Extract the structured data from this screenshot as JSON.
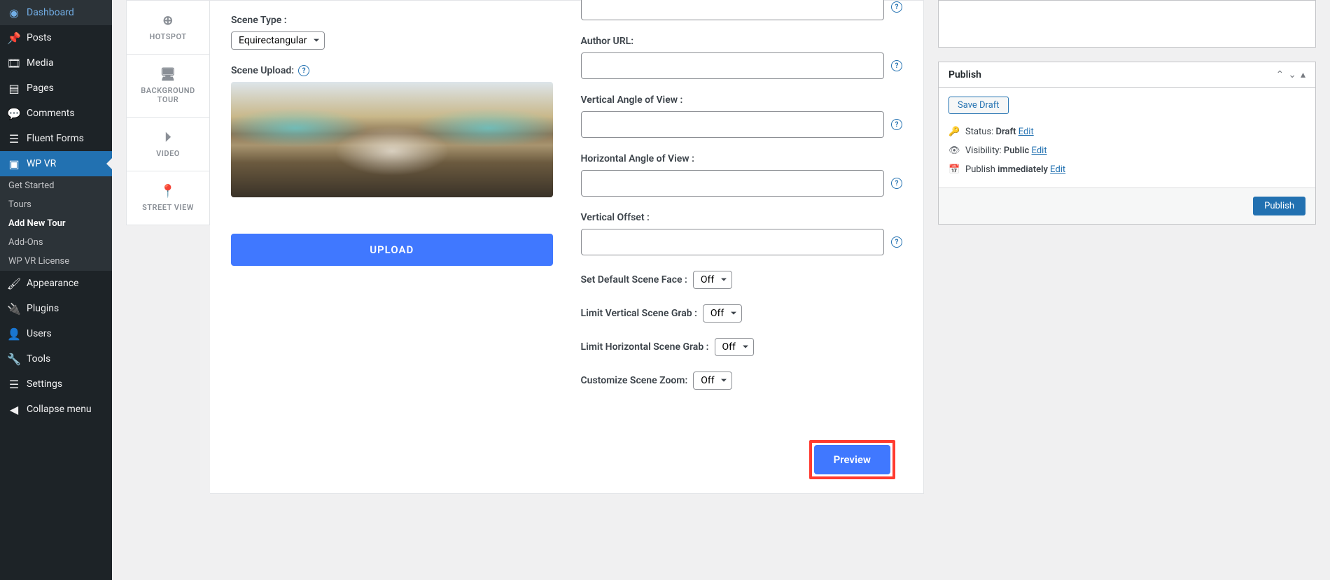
{
  "sidebar": {
    "items": [
      {
        "label": "Dashboard",
        "icon": "◉"
      },
      {
        "label": "Posts",
        "icon": "📌"
      },
      {
        "label": "Media",
        "icon": "🖼"
      },
      {
        "label": "Pages",
        "icon": "📄"
      },
      {
        "label": "Comments",
        "icon": "💬"
      },
      {
        "label": "Fluent Forms",
        "icon": "📋"
      },
      {
        "label": "WP VR",
        "icon": "▣",
        "active": true
      },
      {
        "label": "Appearance",
        "icon": "🖌"
      },
      {
        "label": "Plugins",
        "icon": "🔌"
      },
      {
        "label": "Users",
        "icon": "👤"
      },
      {
        "label": "Tools",
        "icon": "🔧"
      },
      {
        "label": "Settings",
        "icon": "⚙"
      },
      {
        "label": "Collapse menu",
        "icon": "◀"
      }
    ],
    "wpvr_sub": [
      {
        "label": "Get Started"
      },
      {
        "label": "Tours"
      },
      {
        "label": "Add New Tour",
        "current": true
      },
      {
        "label": "Add-Ons"
      },
      {
        "label": "WP VR License"
      }
    ]
  },
  "tabs": [
    {
      "label": "HOTSPOT",
      "icon": "⊕"
    },
    {
      "label": "BACKGROUND TOUR",
      "icon": "🖥"
    },
    {
      "label": "VIDEO",
      "icon": "⏵"
    },
    {
      "label": "STREET VIEW",
      "icon": "📍"
    }
  ],
  "left": {
    "scene_type_label": "Scene Type :",
    "scene_type_value": "Equirectangular",
    "scene_upload_label": "Scene Upload:",
    "upload_btn": "UPLOAD"
  },
  "right": {
    "author_url_label": "Author URL:",
    "vertical_angle_label": "Vertical Angle of View :",
    "horizontal_angle_label": "Horizontal Angle of View :",
    "vertical_offset_label": "Vertical Offset :",
    "default_face_label": "Set Default Scene Face :",
    "default_face_value": "Off",
    "limit_vertical_label": "Limit Vertical Scene Grab :",
    "limit_vertical_value": "Off",
    "limit_horizontal_label": "Limit Horizontal Scene Grab :",
    "limit_horizontal_value": "Off",
    "customize_zoom_label": "Customize Scene Zoom:",
    "customize_zoom_value": "Off"
  },
  "preview_btn": "Preview",
  "publish": {
    "title": "Publish",
    "save_draft": "Save Draft",
    "status_label": "Status: ",
    "status_value": "Draft",
    "visibility_label": "Visibility: ",
    "visibility_value": "Public",
    "publish_label": "Publish ",
    "publish_value": "immediately",
    "edit": "Edit",
    "publish_btn": "Publish"
  }
}
